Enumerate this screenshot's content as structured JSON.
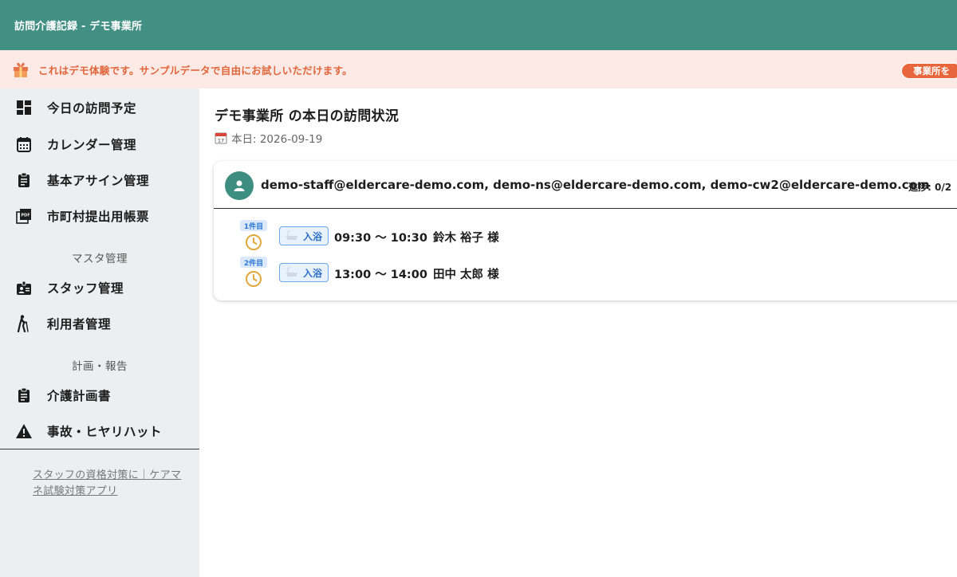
{
  "app": {
    "title": "訪問介護記録 - デモ事業所"
  },
  "banner": {
    "text": "これはデモ体験です。サンプルデータで自由にお試しいただけます。",
    "button_label": "事業所を",
    "gift_icon": "gift-icon"
  },
  "sidebar": {
    "items": [
      {
        "label": "今日の訪問予定",
        "icon": "dashboard-icon"
      },
      {
        "label": "カレンダー管理",
        "icon": "calendar-icon"
      },
      {
        "label": "基本アサイン管理",
        "icon": "clipboard-icon"
      },
      {
        "label": "市町村提出用帳票",
        "icon": "pdf-icon"
      },
      {
        "label": "スタッフ管理",
        "icon": "badge-icon"
      },
      {
        "label": "利用者管理",
        "icon": "elderly-walker-icon"
      },
      {
        "label": "介護計画書",
        "icon": "clipboard-list-icon"
      },
      {
        "label": "事故・ヒヤリハット",
        "icon": "warning-icon"
      }
    ],
    "sections": {
      "master": "マスタ管理",
      "plans": "計画・報告"
    },
    "footer_link": "スタッフの資格対策に｜ケアマネ試験対策アプリ"
  },
  "main": {
    "title": "デモ事業所 の本日の訪問状況",
    "date_label": "本日: 2026-09-19",
    "card": {
      "staff": "demo-staff@eldercare-demo.com, demo-ns@eldercare-demo.com, demo-cw2@eldercare-demo.com",
      "progress": "進捗: 0/2",
      "visits": [
        {
          "badge": "1件目",
          "service": "入浴",
          "time": "09:30 〜 10:30",
          "client": "鈴木 裕子 様"
        },
        {
          "badge": "2件目",
          "service": "入浴",
          "time": "13:00 〜 14:00",
          "client": "田中 太郎 様"
        }
      ]
    }
  },
  "colors": {
    "appbar": "#428f83",
    "banner_bg": "#fde9e6",
    "banner_text": "#e0663a",
    "accent": "#3d8e80",
    "chip_blue": "#2c78d5",
    "clock_orange": "#e2a73b"
  }
}
